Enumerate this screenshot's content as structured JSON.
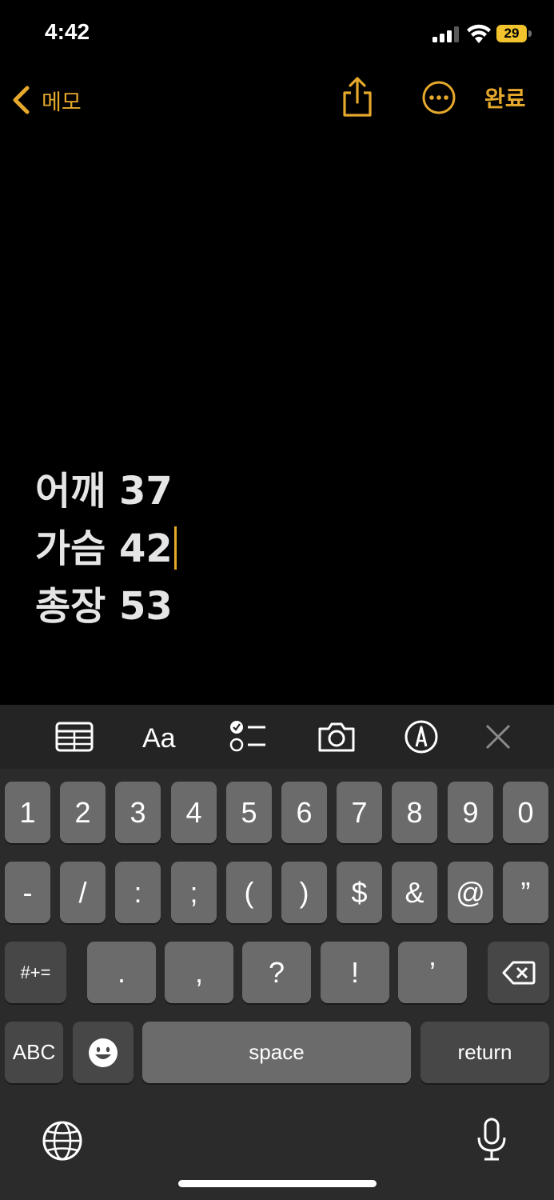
{
  "status_bar": {
    "time": "4:42",
    "battery_level": "29"
  },
  "nav": {
    "back_label": "메모",
    "done_label": "완료"
  },
  "note": {
    "lines": [
      "어깨 37",
      "가슴 42",
      "총장 53"
    ]
  },
  "keyboard": {
    "row1": [
      "1",
      "2",
      "3",
      "4",
      "5",
      "6",
      "7",
      "8",
      "9",
      "0"
    ],
    "row2": [
      "-",
      "/",
      ":",
      ";",
      "(",
      ")",
      "$",
      "&",
      "@",
      "”"
    ],
    "row3": {
      "shift_label": "#+=",
      "keys": [
        ".",
        ",",
        "?",
        "!",
        "’"
      ]
    },
    "row4": {
      "abc_label": "ABC",
      "space_label": "space",
      "return_label": "return"
    }
  },
  "colors": {
    "accent": "#e6a92c",
    "background": "#000000",
    "key": "#6b6b6b",
    "key_dark": "#474747"
  }
}
